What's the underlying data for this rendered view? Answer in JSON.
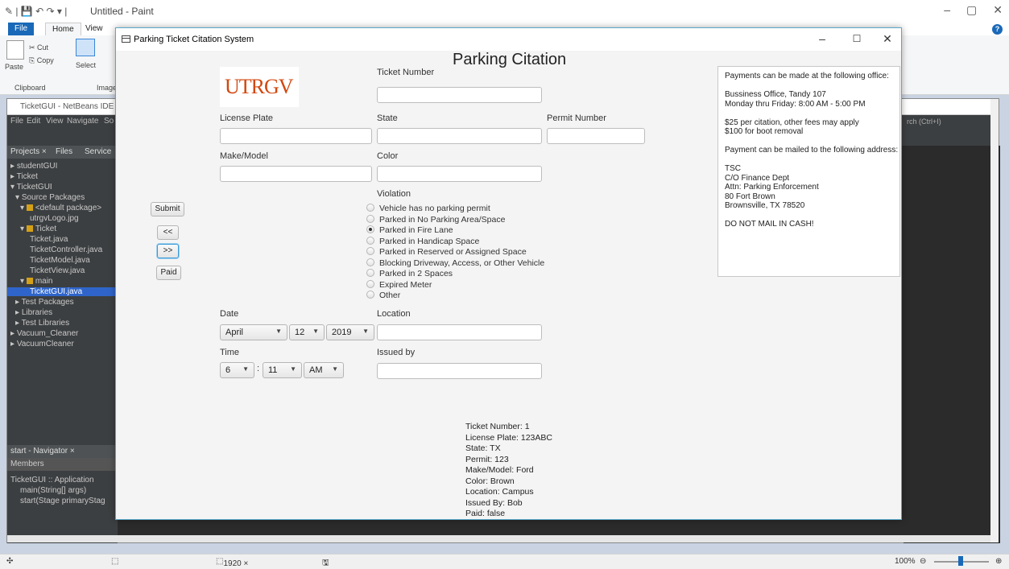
{
  "paint": {
    "title": "Untitled - Paint",
    "tabs": [
      "File",
      "Home",
      "View"
    ],
    "clipboard": {
      "paste": "Paste",
      "cut": "Cut",
      "copy": "Copy",
      "group": "Clipboard"
    },
    "image": {
      "select": "Select",
      "group": "Image"
    },
    "status": {
      "dimensions": "1920 × 1080px",
      "zoom": "100%"
    }
  },
  "netbeans": {
    "title": "TicketGUI - NetBeans IDE 8",
    "menu": [
      "File",
      "Edit",
      "View",
      "Navigate",
      "So"
    ],
    "search": "rch (Ctrl+I)",
    "tabs": {
      "projects": "Projects ×",
      "files": "Files",
      "services": "Service"
    },
    "tree": [
      "studentGUI",
      "Ticket",
      "TicketGUI",
      "Source Packages",
      "<default package>",
      "utrgvLogo.jpg",
      "Ticket",
      "Ticket.java",
      "TicketController.java",
      "TicketModel.java",
      "TicketView.java",
      "main",
      "TicketGUI.java",
      "Test Packages",
      "Libraries",
      "Test Libraries",
      "Vacuum_Cleaner",
      "VacuumCleaner"
    ],
    "navigator_title": "start - Navigator ×",
    "members_label": "Members",
    "navigator_items": [
      "TicketGUI :: Application",
      "main(String[] args)",
      "start(Stage primaryStag"
    ]
  },
  "dialog": {
    "title": "Parking Ticket Citation System",
    "heading": "Parking Citation",
    "logo_text": "UTRGV",
    "labels": {
      "ticket_number": "Ticket Number",
      "license_plate": "License Plate",
      "state": "State",
      "permit_number": "Permit Number",
      "make_model": "Make/Model",
      "color": "Color",
      "violation": "Violation",
      "date": "Date",
      "location": "Location",
      "time": "Time",
      "issued_by": "Issued by"
    },
    "buttons": {
      "submit": "Submit",
      "prev": "<<",
      "next": ">>",
      "paid": "Paid"
    },
    "violations": [
      {
        "label": "Vehicle has no parking permit",
        "checked": false
      },
      {
        "label": "Parked in No Parking Area/Space",
        "checked": false
      },
      {
        "label": "Parked in Fire Lane",
        "checked": true
      },
      {
        "label": "Parked in Handicap Space",
        "checked": false
      },
      {
        "label": "Parked in Reserved or Assigned Space",
        "checked": false
      },
      {
        "label": "Blocking Driveway, Access, or Other Vehicle",
        "checked": false
      },
      {
        "label": "Parked in 2 Spaces",
        "checked": false
      },
      {
        "label": "Expired Meter",
        "checked": false
      },
      {
        "label": "Other",
        "checked": false
      }
    ],
    "date": {
      "month": "April",
      "day": "12",
      "year": "2019"
    },
    "time": {
      "hour": "6",
      "separator": ":",
      "minute": "11",
      "ampm": "AM"
    },
    "payment_info": [
      "Payments can be made at the following office:",
      "",
      "Bussiness Office, Tandy 107",
      "Monday thru Friday: 8:00 AM - 5:00 PM",
      "",
      "$25 per citation, other fees may apply",
      "$100 for boot removal",
      "",
      "Payment can be mailed to the following address:",
      "",
      "TSC",
      "C/O Finance Dept",
      "Attn: Parking Enforcement",
      "80 Fort Brown",
      "Brownsville, TX 78520",
      "",
      "DO NOT MAIL IN CASH!"
    ],
    "summary": [
      "Ticket Number: 1",
      "License Plate: 123ABC",
      "State: TX",
      "Permit: 123",
      "Make/Model: Ford",
      "Color: Brown",
      "Location: Campus",
      "Issued By: Bob",
      "Paid: false"
    ]
  }
}
